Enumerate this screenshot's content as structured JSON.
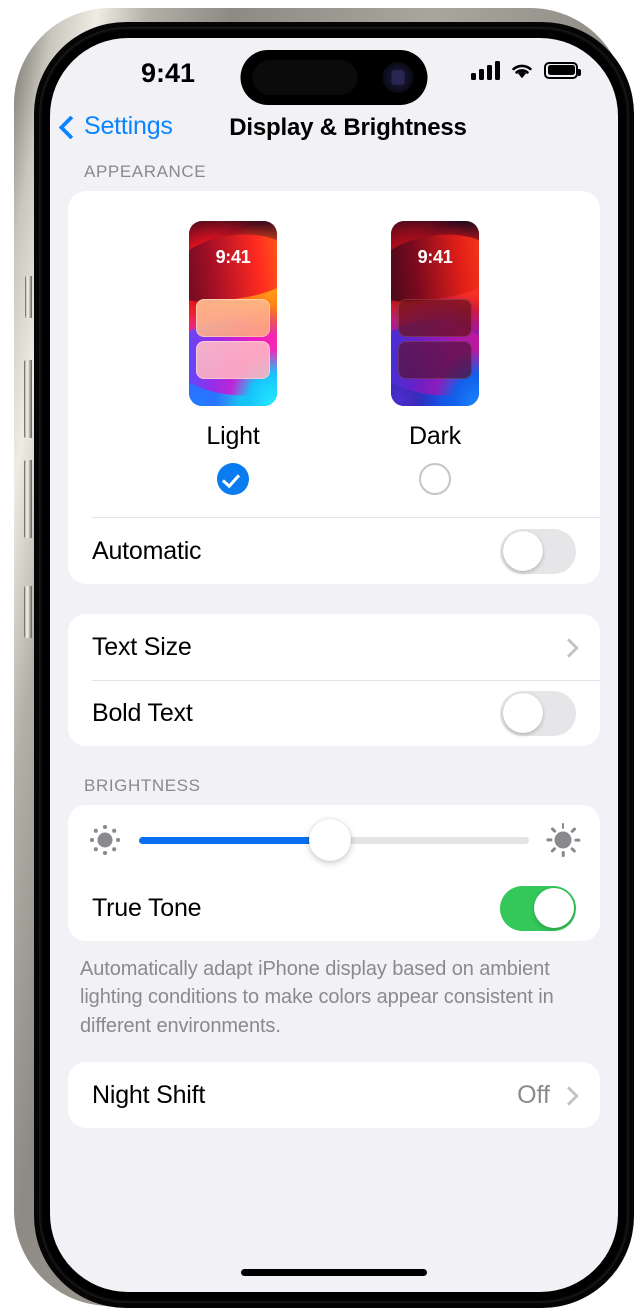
{
  "status_bar": {
    "time": "9:41",
    "cellular_icon": "signal-bars-icon",
    "wifi_icon": "wifi-icon",
    "battery_icon": "battery-full-icon"
  },
  "nav": {
    "back_label": "Settings",
    "back_icon": "chevron-left-icon",
    "title": "Display & Brightness"
  },
  "appearance": {
    "header": "APPEARANCE",
    "options": [
      {
        "label": "Light",
        "preview_time": "9:41",
        "selected": true,
        "radio_icon": "checkmark-circle-icon"
      },
      {
        "label": "Dark",
        "preview_time": "9:41",
        "selected": false,
        "radio_icon": "empty-circle-icon"
      }
    ],
    "automatic": {
      "label": "Automatic",
      "enabled": false
    }
  },
  "text_group": {
    "text_size": {
      "label": "Text Size",
      "chevron_icon": "chevron-right-icon"
    },
    "bold_text": {
      "label": "Bold Text",
      "enabled": false
    }
  },
  "brightness": {
    "header": "BRIGHTNESS",
    "slider": {
      "value_percent": 49,
      "low_icon": "sun-small-icon",
      "high_icon": "sun-large-icon"
    },
    "true_tone": {
      "label": "True Tone",
      "enabled": true
    },
    "footnote": "Automatically adapt iPhone display based on ambient lighting conditions to make colors appear consistent in different environments."
  },
  "night_shift": {
    "label": "Night Shift",
    "value": "Off",
    "chevron_icon": "chevron-right-icon"
  },
  "colors": {
    "accent_blue": "#0a84ff",
    "slider_blue": "#0a6ff0",
    "toggle_green": "#34c759",
    "selected_blue": "#0a7cf0",
    "background": "#f2f1f6",
    "card": "#ffffff",
    "secondary_text": "#8a8a8e"
  }
}
